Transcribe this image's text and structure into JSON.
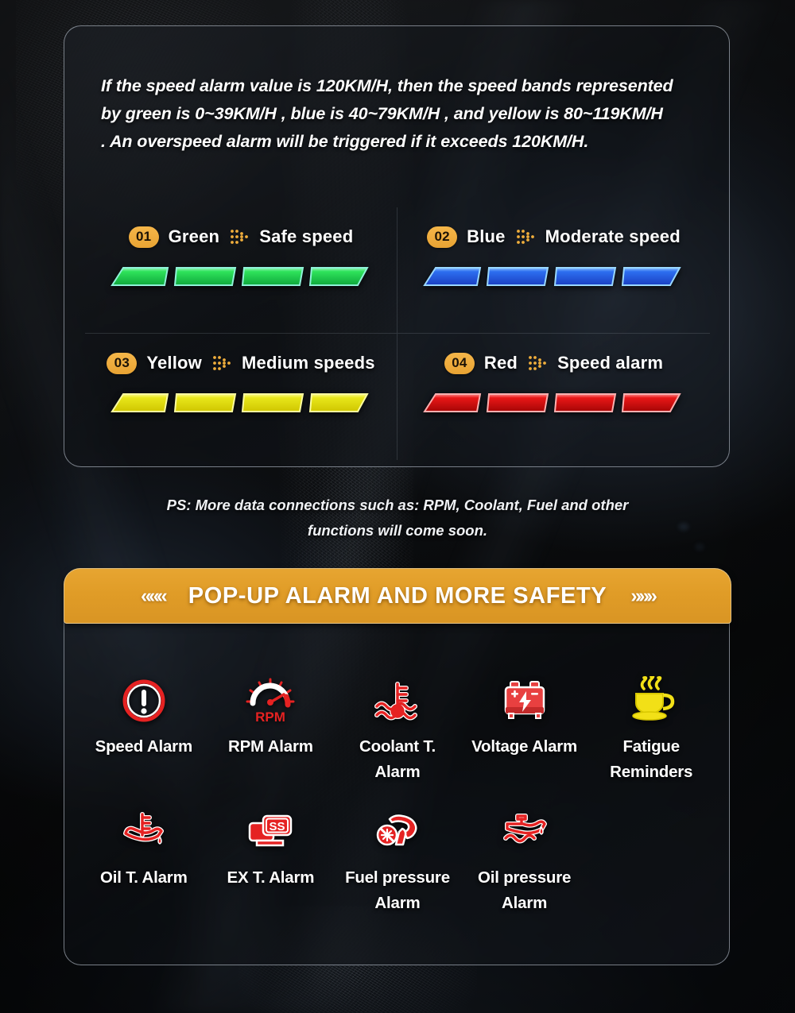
{
  "intro": {
    "line1": "If the speed alarm value is 120KM/H, then the speed bands represented",
    "line2": "by green is 0~39KM/H , blue is 40~79KM/H , and yellow is 80~119KM/H",
    "line3": ". An overspeed alarm will be triggered if it exceeds 120KM/H."
  },
  "legend": {
    "items": [
      {
        "num": "01",
        "color_name": "Green",
        "description": "Safe speed",
        "hex": "#2ee35a",
        "hex_dark": "#0fa83c",
        "edge": "#7ff0d0"
      },
      {
        "num": "02",
        "color_name": "Blue",
        "description": "Moderate speed",
        "hex": "#2d6ff0",
        "hex_dark": "#1a3fc2",
        "edge": "#9ad8ff"
      },
      {
        "num": "03",
        "color_name": "Yellow",
        "description": "Medium  speeds",
        "hex": "#e8e61a",
        "hex_dark": "#c9c000",
        "edge": "#fdfda0"
      },
      {
        "num": "04",
        "color_name": "Red",
        "description": "Speed alarm",
        "hex": "#e81717",
        "hex_dark": "#a60505",
        "edge": "#ff9d9d"
      }
    ],
    "arrow_icon": "dotted-arrow-icon",
    "bars_per_item": 4
  },
  "ps_note": {
    "line1": "PS: More data connections such as: RPM, Coolant, Fuel and other",
    "line2": "functions will come soon."
  },
  "banner": {
    "left_chevrons": "«««",
    "title": "POP-UP ALARM AND MORE SAFETY",
    "right_chevrons": "»»»"
  },
  "alarms": {
    "row1": [
      {
        "label": "Speed Alarm",
        "icon": "exclamation-circle-icon",
        "color": "#e52222"
      },
      {
        "label": "RPM Alarm",
        "icon": "rpm-gauge-icon",
        "color": "#e52222"
      },
      {
        "label": "Coolant T.\nAlarm",
        "icon": "coolant-temp-icon",
        "color": "#e52222"
      },
      {
        "label": "Voltage Alarm",
        "icon": "battery-icon",
        "color": "#e84040"
      },
      {
        "label": "Fatigue\nReminders",
        "icon": "coffee-cup-icon",
        "color": "#f2e017"
      }
    ],
    "row2": [
      {
        "label": "Oil T. Alarm",
        "icon": "oil-temp-icon",
        "color": "#e52222"
      },
      {
        "label": "EX T. Alarm",
        "icon": "ss-card-icon",
        "color": "#e52222"
      },
      {
        "label": "Fuel pressure\nAlarm",
        "icon": "fuel-pressure-icon",
        "color": "#e52222"
      },
      {
        "label": "Oil pressure\nAlarm",
        "icon": "oil-pressure-icon",
        "color": "#e52222"
      },
      {
        "label": "",
        "icon": "",
        "color": ""
      }
    ]
  },
  "theme": {
    "accent_orange": "#e7a531",
    "badge_orange": "#f0ae3c",
    "panel_border": "#cdd7e4",
    "text_white": "#ffffff"
  }
}
